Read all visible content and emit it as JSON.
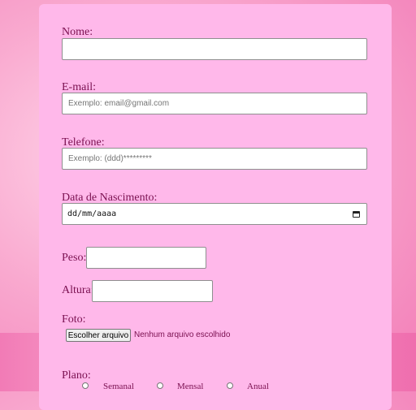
{
  "form": {
    "nome": {
      "label": "Nome:",
      "value": ""
    },
    "email": {
      "label": "E-mail:",
      "placeholder": "Exemplo: email@gmail.com"
    },
    "telefone": {
      "label": "Telefone:",
      "placeholder": "Exemplo: (ddd)*********"
    },
    "nascimento": {
      "label": "Data de Nascimento:",
      "value_text": "dd/mm/aaaa",
      "icon": "calendar-icon"
    },
    "peso": {
      "label": "Peso:",
      "value": ""
    },
    "altura": {
      "label": "Altura:",
      "value": ""
    },
    "foto": {
      "label": "Foto:",
      "button": "Escolher arquivo",
      "status": "Nenhum arquivo escolhido"
    },
    "plano": {
      "label": "Plano:",
      "options": [
        {
          "label": "Semanal",
          "checked": false
        },
        {
          "label": "Mensal",
          "checked": false
        },
        {
          "label": "Anual",
          "checked": false
        }
      ]
    }
  },
  "colors": {
    "panel": "#ffb8ea",
    "label_text": "#7a1050",
    "background_accent": "#f27bb6"
  }
}
